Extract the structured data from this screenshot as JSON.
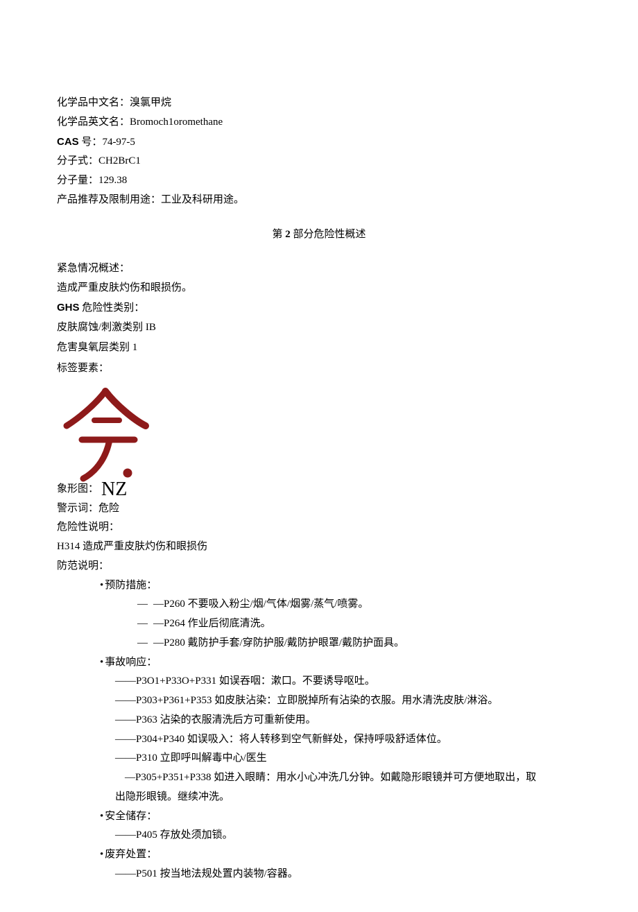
{
  "header": {
    "cn_name_label": "化学品中文名：",
    "cn_name": "溴氯甲烷",
    "en_name_label": "化学品英文名：",
    "en_name": "Bromoch1oromethane",
    "cas_label_bold": "CAS",
    "cas_label_rest": " 号：",
    "cas": "74-97-5",
    "formula_label": "分子式：",
    "formula": "CH2BrC1",
    "mw_label": "分子量：",
    "mw": "129.38",
    "use_label": "产品推荐及限制用途：",
    "use": "工业及科研用途。"
  },
  "section2": {
    "title_prefix": "第",
    "title_num": " 2 ",
    "title_suffix": "部分危险性概述"
  },
  "body": {
    "emergency_label": "紧急情况概述：",
    "emergency_text": "造成严重皮肤灼伤和眼损伤。",
    "ghs_label_bold": "GHS",
    "ghs_label_rest": " 危险性类别：",
    "class1": "皮肤腐蚀/刺激类别 IB",
    "class2": "危害臭氧层类别 1",
    "label_elements": "标签要素：",
    "pictogram_label": "象形图：",
    "pictogram_code": "NZ",
    "signal_label": "警示词：",
    "signal": "危险",
    "hazard_label": "危险性说明：",
    "hazard_h314": "H314 造成严重皮肤灼伤和眼损伤",
    "precaution_label": "防范说明：",
    "prevent_h": "预防措施：",
    "p260": "—P260 不要吸入粉尘/烟/气体/烟雾/蒸气/喷雾。",
    "p264": "—P264 作业后彻底清洗。",
    "p280": "—P280 戴防护手套/穿防护服/戴防护眼罩/戴防护面具。",
    "response_h": "事故响应：",
    "p301": "——P3O1+P33O+P331 如误吞咽：漱口。不要诱导呕吐。",
    "p303": "——P303+P361+P353 如皮肤沾染：立即脱掉所有沾染的衣服。用水清洗皮肤/淋浴。",
    "p363": "——P363 沾染的衣服清洗后方可重新使用。",
    "p304": "——P304+P340 如误吸入：将人转移到空气新鲜处，保持呼吸舒适体位。",
    "p310": "——P310 立即呼叫解毒中心/医生",
    "p305a": "—P305+P351+P338 如进入眼睛：用水小心冲洗几分钟。如戴隐形眼镜并可方便地取出，取",
    "p305b": "出隐形眼镜。继续冲洗。",
    "storage_h": "安全储存：",
    "p405": "——P405 存放处须加锁。",
    "disposal_h": "废弃处置：",
    "p501": "——P501 按当地法规处置内装物/容器。"
  }
}
